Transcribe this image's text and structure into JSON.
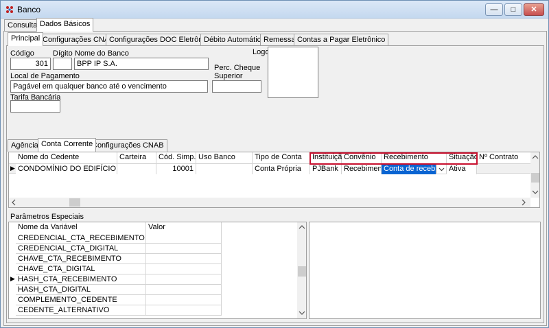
{
  "window": {
    "title": "Banco",
    "minimize": "—",
    "maximize": "□",
    "close": "✕"
  },
  "main_tabs": [
    "Consulta",
    "Dados Básicos"
  ],
  "sub_tabs": [
    "Principal",
    "Configurações CNAB",
    "Configurações DOC Eletrônico",
    "Débito Automático",
    "Remessa",
    "Contas a Pagar Eletrônico"
  ],
  "form": {
    "codigo_label": "Código",
    "codigo_value": "301",
    "digito_label": "Dígito",
    "digito_value": "",
    "nome_banco_label": "Nome do Banco",
    "nome_banco_value": "BPP IP S.A.",
    "perc_cheque_label_1": "Perc. Cheque",
    "perc_cheque_label_2": "Superior",
    "perc_cheque_value": "",
    "logo_label": "Logo",
    "local_pagamento_label": "Local de Pagamento",
    "local_pagamento_value": "Pagável em qualquer banco até o vencimento",
    "tarifa_label": "Tarifa Bancária",
    "tarifa_value": ""
  },
  "lower_tabs": [
    "Agência",
    "Conta Corrente",
    "Configurações CNAB"
  ],
  "conta_grid": {
    "headers": [
      "Nome do Cedente",
      "Carteira",
      "Cód. Simp.",
      "Uso Banco",
      "Tipo de Conta",
      "Instituição",
      "Convênio",
      "Recebimento",
      "Situação",
      "Nº Contrato"
    ],
    "row": [
      "CONDOMÍNIO DO EDIFÍCIO",
      "",
      "10001",
      "",
      "Conta Própria",
      "PJBank",
      "Recebimento",
      "Conta de recebime",
      "Ativa",
      ""
    ],
    "row_marker": "▶",
    "dropdown_icon": "chevron-down-icon",
    "highlight_color": "#c8102e",
    "selection_color": "#0a64d2"
  },
  "params": {
    "section_label": "Parâmetros Especiais",
    "col_nome": "Nome da Variável",
    "col_valor": "Valor",
    "rows": [
      "CREDENCIAL_CTA_RECEBIMENTO",
      "CREDENCIAL_CTA_DIGITAL",
      "CHAVE_CTA_RECEBIMENTO",
      "CHAVE_CTA_DIGITAL",
      "HASH_CTA_RECEBIMENTO",
      "HASH_CTA_DIGITAL",
      "COMPLEMENTO_CEDENTE",
      "CEDENTE_ALTERNATIVO"
    ],
    "selected_marker": "▶"
  }
}
